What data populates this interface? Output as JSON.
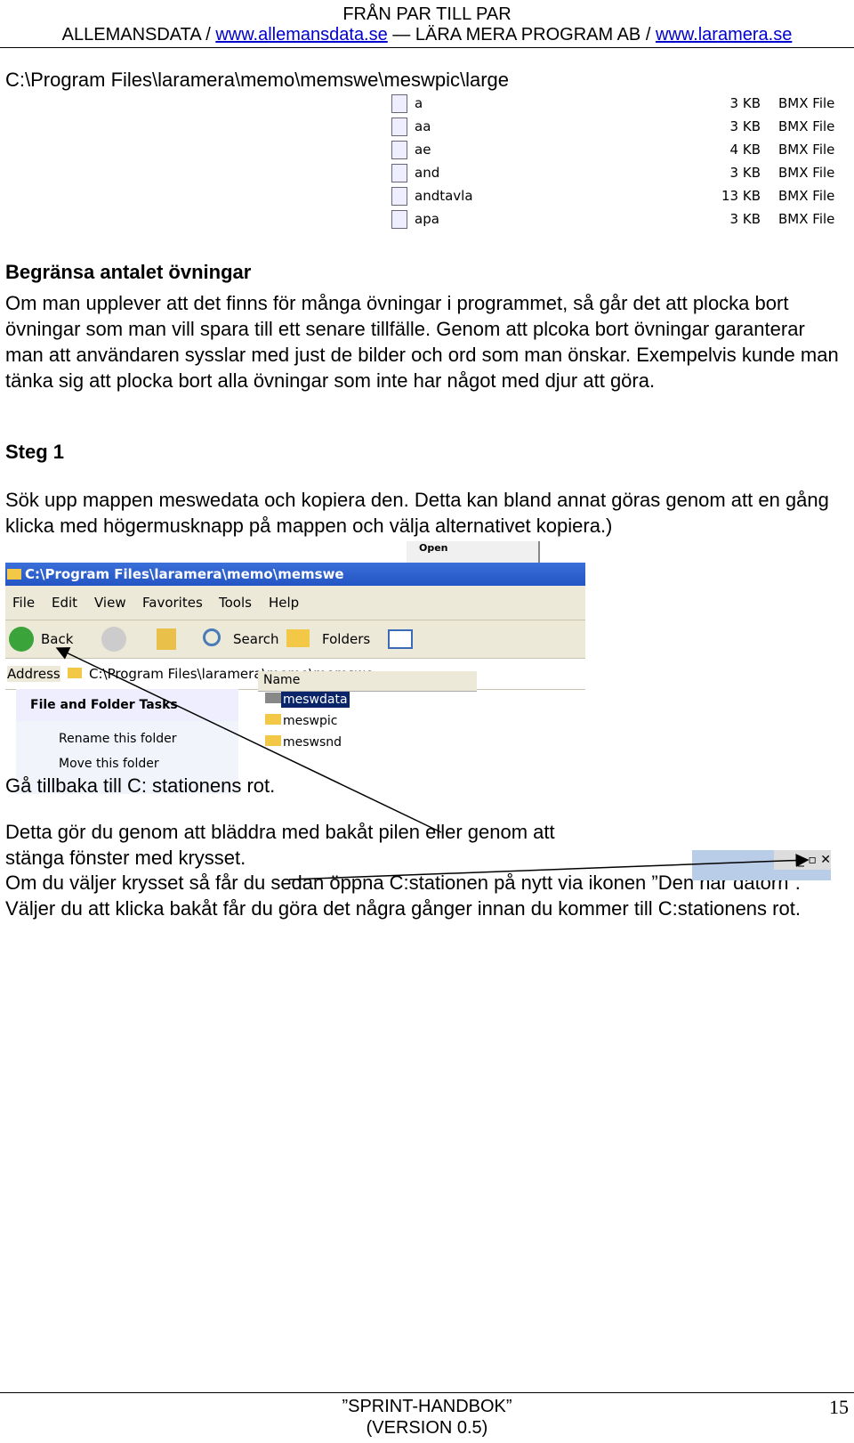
{
  "header": {
    "line1": "FRÅN PAR TILL PAR",
    "company1": "ALLEMANSDATA / ",
    "link1": "www.allemansdata.se",
    "sep": " — LÄRA MERA PROGRAM AB / ",
    "link2": "www.laramera.se"
  },
  "path_title": "C:\\Program Files\\laramera\\memo\\memswe\\meswpic\\large",
  "files": [
    {
      "name": "a",
      "size": "3 KB",
      "type": "BMX File"
    },
    {
      "name": "aa",
      "size": "3 KB",
      "type": "BMX File"
    },
    {
      "name": "ae",
      "size": "4 KB",
      "type": "BMX File"
    },
    {
      "name": "and",
      "size": "3 KB",
      "type": "BMX File"
    },
    {
      "name": "andtavla",
      "size": "13 KB",
      "type": "BMX File"
    },
    {
      "name": "apa",
      "size": "3 KB",
      "type": "BMX File"
    }
  ],
  "section_heading": "Begränsa antalet övningar",
  "section_body": "Om man upplever att det finns för många övningar i programmet, så går det att plocka bort övningar som man vill spara till ett senare tillfälle. Genom att plcoka bort övningar garanterar man att användaren sysslar med just de bilder och ord som man önskar. Exempelvis kunde man tänka sig att plocka bort alla övningar som inte har något med djur att göra.",
  "step_heading": "Steg 1",
  "step_body": "Sök upp mappen meswedata och kopiera den. Detta kan bland annat göras genom att en gång klicka med högermusknapp på mappen och välja alternativet kopiera.)",
  "context_menu": {
    "item": "Open"
  },
  "explorer": {
    "title": "C:\\Program Files\\laramera\\memo\\memswe",
    "menu": [
      "File",
      "Edit",
      "View",
      "Favorites",
      "Tools",
      "Help"
    ],
    "toolbar": {
      "back": "Back",
      "search": "Search",
      "folders": "Folders"
    },
    "address_label": "Address",
    "address_value": "C:\\Program Files\\laramera\\memo\\memswe",
    "tasks_title": "File and Folder Tasks",
    "tasks": [
      "Rename this folder",
      "Move this folder"
    ],
    "column_name": "Name",
    "folders": [
      "meswdata",
      "meswpic",
      "meswsnd"
    ],
    "selected_folder": "meswdata"
  },
  "para_root": "Gå tillbaka till C: stationens rot.",
  "para_back1": "Detta gör du genom att bläddra med bakåt pilen eller genom att",
  "para_back2": "stänga fönster med krysset.",
  "para_more": "Om du väljer krysset så får du sedan öppna C:stationen på nytt via ikonen ”Den här datorn”. Väljer du att klicka bakåt får du göra det några gånger innan du kommer till C:stationens rot.",
  "footer": {
    "title": "”SPRINT-HANDBOK”",
    "version": "(VERSION 0.5)",
    "page": "15"
  },
  "colors": {
    "link": "#0000cc",
    "titlebar": "#2c5fcf",
    "selection": "#0a246a",
    "toolbar_bg": "#ece9d8"
  }
}
